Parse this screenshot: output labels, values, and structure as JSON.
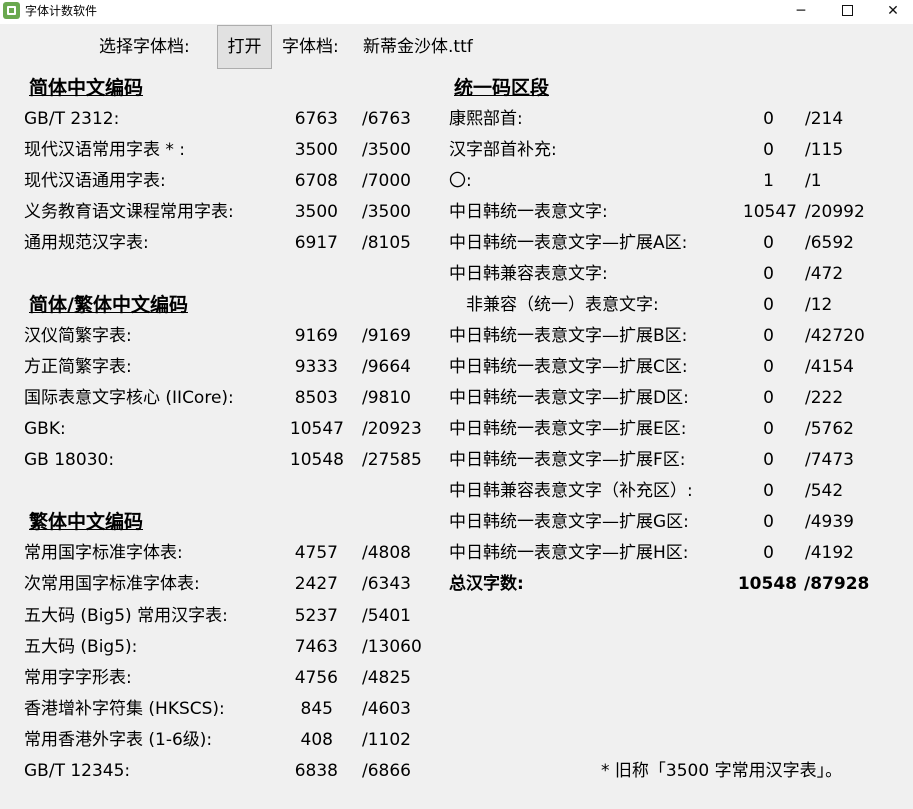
{
  "window": {
    "title": "字体计数软件",
    "minimize": "─",
    "close": "✕",
    "icon": "app-icon"
  },
  "toolbar": {
    "select_label": "选择字体档:",
    "open_button": "打开",
    "file_label": "字体档:",
    "file_name": "新蒂金沙体.ttf"
  },
  "left": {
    "sections": [
      {
        "title": "简体中文编码",
        "rows": [
          {
            "label": "GB/T 2312:",
            "count": "6763",
            "total": "/6763"
          },
          {
            "label": "现代汉语常用字表 * :",
            "count": "3500",
            "total": "/3500"
          },
          {
            "label": "现代汉语通用字表:",
            "count": "6708",
            "total": "/7000"
          },
          {
            "label": "义务教育语文课程常用字表:",
            "count": "3500",
            "total": "/3500"
          },
          {
            "label": "通用规范汉字表:",
            "count": "6917",
            "total": "/8105"
          }
        ]
      },
      {
        "title": "简体/繁体中文编码",
        "rows": [
          {
            "label": "汉仪简繁字表:",
            "count": "9169",
            "total": "/9169"
          },
          {
            "label": "方正简繁字表:",
            "count": "9333",
            "total": "/9664"
          },
          {
            "label": "国际表意文字核心 (IICore):",
            "count": "8503",
            "total": "/9810"
          },
          {
            "label": "GBK:",
            "count": "10547",
            "total": "/20923"
          },
          {
            "label": "GB 18030:",
            "count": "10548",
            "total": "/27585"
          }
        ]
      },
      {
        "title": "繁体中文编码",
        "rows": [
          {
            "label": "常用国字标准字体表:",
            "count": "4757",
            "total": "/4808"
          },
          {
            "label": "次常用国字标准字体表:",
            "count": "2427",
            "total": "/6343"
          },
          {
            "label": "五大码 (Big5) 常用汉字表:",
            "count": "5237",
            "total": "/5401"
          },
          {
            "label": "五大码 (Big5):",
            "count": "7463",
            "total": "/13060"
          },
          {
            "label": "常用字字形表:",
            "count": "4756",
            "total": "/4825"
          },
          {
            "label": "香港增补字符集 (HKSCS):",
            "count": "845",
            "total": "/4603"
          },
          {
            "label": "常用香港外字表 (1-6级):",
            "count": "408",
            "total": "/1102"
          },
          {
            "label": "GB/T 12345:",
            "count": "6838",
            "total": "/6866"
          }
        ]
      }
    ]
  },
  "right": {
    "title": "统一码区段",
    "rows": [
      {
        "label": "康熙部首:",
        "count": "0",
        "total": "/214"
      },
      {
        "label": "汉字部首补充:",
        "count": "0",
        "total": "/115"
      },
      {
        "label": "〇:",
        "count": "1",
        "total": "/1"
      },
      {
        "label": "中日韩统一表意文字:",
        "count": "10547",
        "total": "/20992"
      },
      {
        "label": "中日韩统一表意文字—扩展A区:",
        "count": "0",
        "total": "/6592"
      },
      {
        "label": "中日韩兼容表意文字:",
        "count": "0",
        "total": "/472"
      },
      {
        "label": "非兼容（统一）表意文字:",
        "count": "0",
        "total": "/12"
      },
      {
        "label": "中日韩统一表意文字—扩展B区:",
        "count": "0",
        "total": "/42720"
      },
      {
        "label": "中日韩统一表意文字—扩展C区:",
        "count": "0",
        "total": "/4154"
      },
      {
        "label": "中日韩统一表意文字—扩展D区:",
        "count": "0",
        "total": "/222"
      },
      {
        "label": "中日韩统一表意文字—扩展E区:",
        "count": "0",
        "total": "/5762"
      },
      {
        "label": "中日韩统一表意文字—扩展F区:",
        "count": "0",
        "total": "/7473"
      },
      {
        "label": "中日韩兼容表意文字（补充区）:",
        "count": "0",
        "total": "/542"
      },
      {
        "label": "中日韩统一表意文字—扩展G区:",
        "count": "0",
        "total": "/4939"
      },
      {
        "label": "中日韩统一表意文字—扩展H区:",
        "count": "0",
        "total": "/4192"
      }
    ],
    "sum": {
      "label": "总汉字数:",
      "count": "10548",
      "total": "/87928"
    }
  },
  "footnote": "* 旧称「3500 字常用汉字表」。"
}
